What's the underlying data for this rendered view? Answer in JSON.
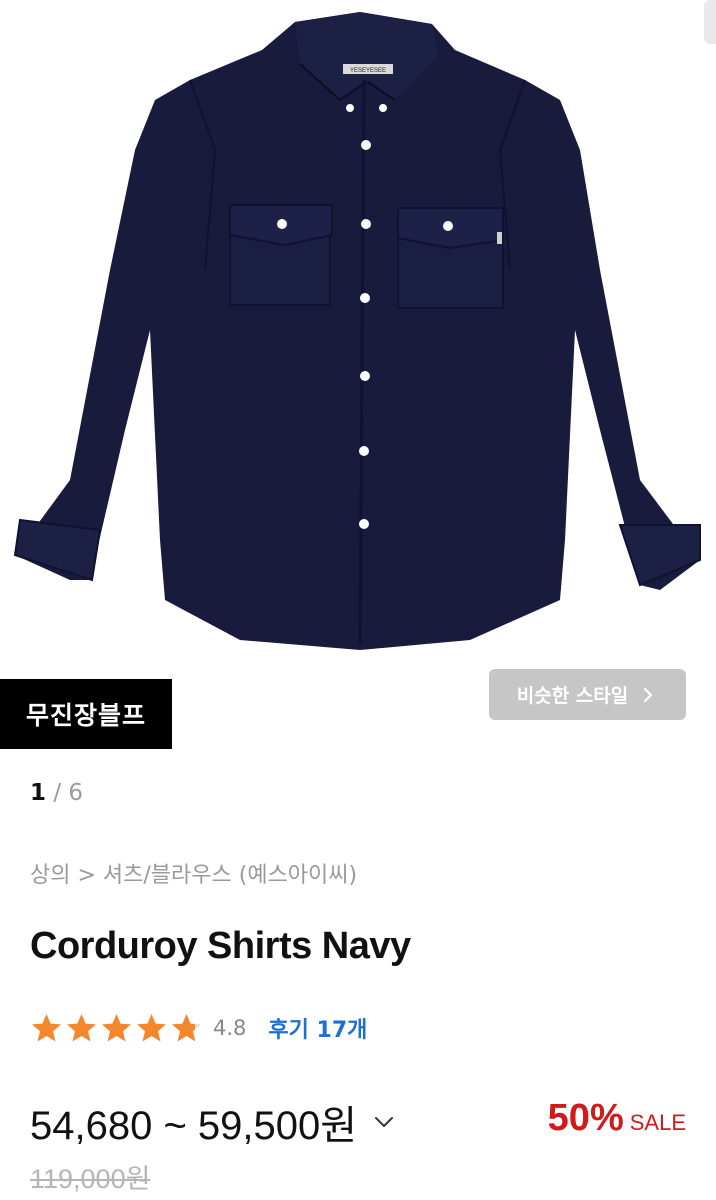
{
  "product_image": {
    "alt_icon": "shirt-icon",
    "shirt_color": "#181b3b",
    "label_text": "YESEYESEE"
  },
  "brand_badge": {
    "label": "무진장블프"
  },
  "similar_style": {
    "label": "비슷한 스타일",
    "icon": "chevron-right-icon"
  },
  "pager": {
    "current": "1",
    "separator": " / ",
    "total": "6"
  },
  "breadcrumb": {
    "text": "상의 > 셔츠/블라우스 (예스아이씨)"
  },
  "product": {
    "title": "Corduroy Shirts Navy",
    "rating": {
      "stars": 4.8,
      "score_label": "4.8",
      "reviews_label": "후기 17개"
    },
    "price_range": "54,680 ~ 59,500원",
    "discount": {
      "percent": "50%",
      "label": "SALE"
    },
    "original_price": "119,000원"
  },
  "colors": {
    "star": "#f4862b",
    "sale": "#d11a1a",
    "review_link": "#1f6fd1",
    "badge_bg": "#000000"
  }
}
